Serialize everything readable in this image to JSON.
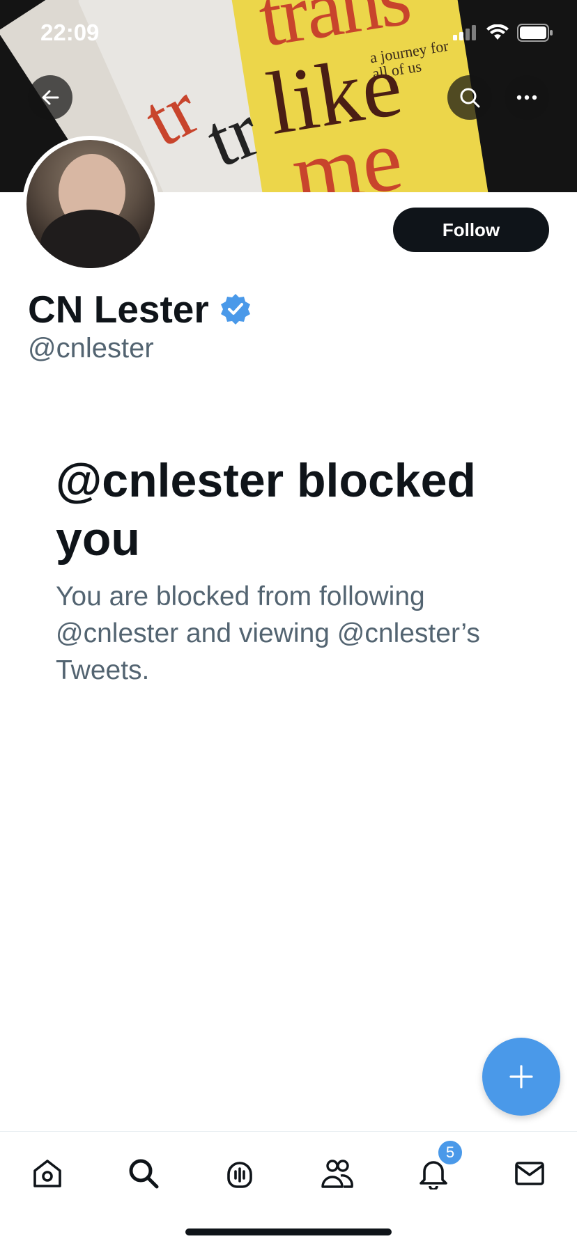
{
  "status_bar": {
    "time": "22:09"
  },
  "banner": {
    "book_text": {
      "trans": "trans",
      "like": "like",
      "me": "me",
      "subtitle": "a journey for all of us",
      "tr": "tr"
    }
  },
  "profile": {
    "display_name": "CN Lester",
    "handle": "@cnlester",
    "follow_label": "Follow",
    "verified": true
  },
  "blocked_notice": {
    "title": "@cnlester blocked you",
    "body": "You are blocked from following @cnlester and viewing @cnlester’s Tweets."
  },
  "tab_bar": {
    "items": [
      {
        "name": "home",
        "icon": "home-icon"
      },
      {
        "name": "search",
        "icon": "search-icon"
      },
      {
        "name": "spaces",
        "icon": "spaces-icon"
      },
      {
        "name": "communities",
        "icon": "communities-icon"
      },
      {
        "name": "notifications",
        "icon": "bell-icon"
      },
      {
        "name": "messages",
        "icon": "mail-icon"
      }
    ],
    "notifications_badge": "5"
  },
  "colors": {
    "accent": "#4a99e9",
    "text_primary": "#0f1419",
    "text_secondary": "#536471"
  }
}
